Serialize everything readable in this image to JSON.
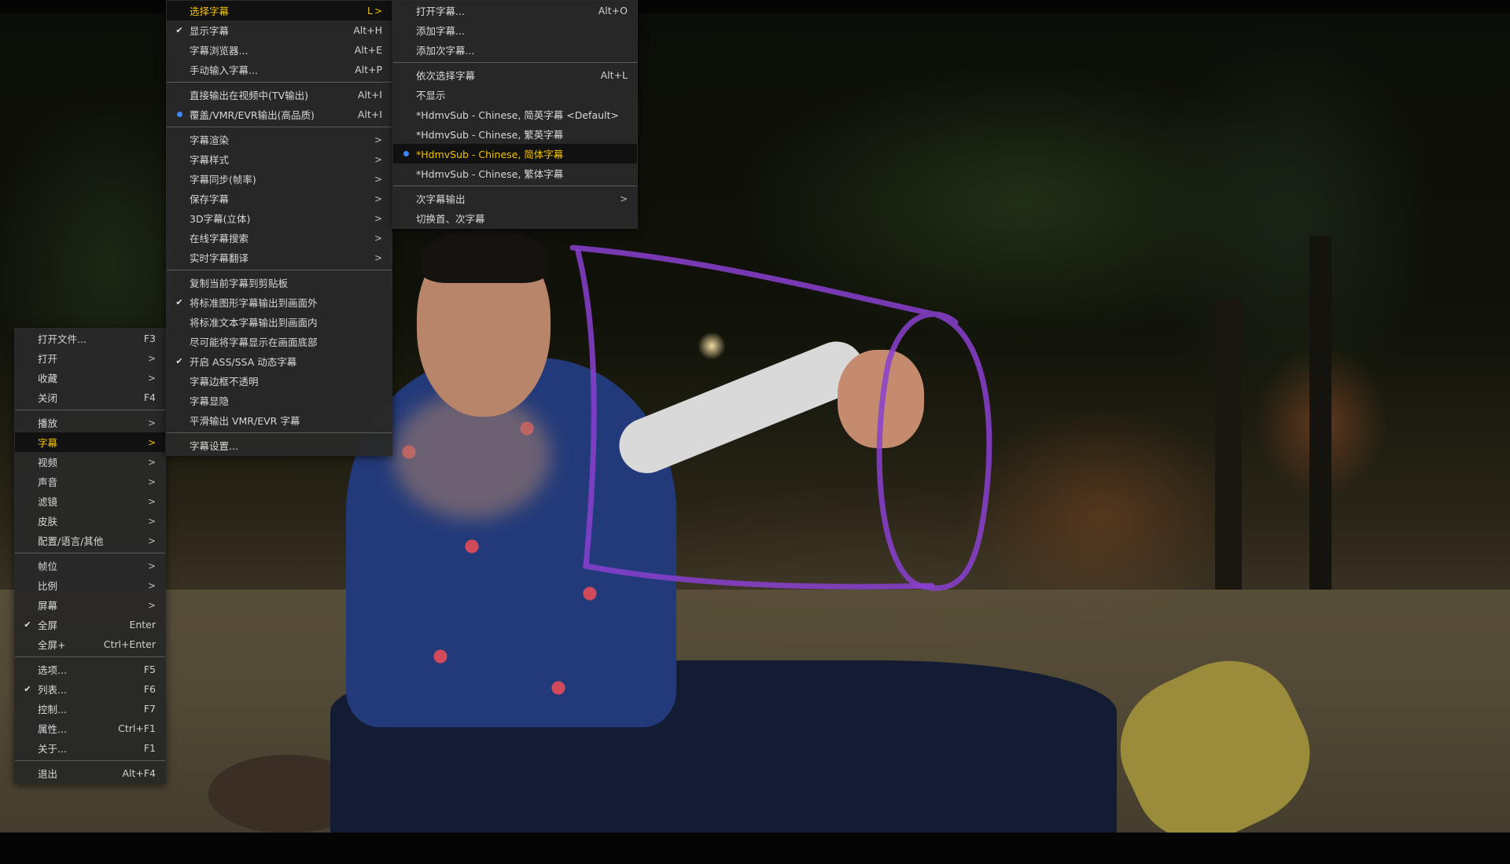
{
  "player_menu": {
    "items": [
      {
        "label": "打开文件...",
        "shortcut": "F3"
      },
      {
        "label": "打开",
        "arrow": ">"
      },
      {
        "label": "收藏",
        "arrow": ">"
      },
      {
        "label": "关闭",
        "shortcut": "F4"
      },
      {
        "label": "播放",
        "arrow": ">"
      },
      {
        "label": "字幕",
        "arrow": ">"
      },
      {
        "label": "视频",
        "arrow": ">"
      },
      {
        "label": "声音",
        "arrow": ">"
      },
      {
        "label": "滤镜",
        "arrow": ">"
      },
      {
        "label": "皮肤",
        "arrow": ">"
      },
      {
        "label": "配置/语言/其他",
        "arrow": ">"
      },
      {
        "label": "帧位",
        "arrow": ">"
      },
      {
        "label": "比例",
        "arrow": ">"
      },
      {
        "label": "屏幕",
        "arrow": ">"
      },
      {
        "label": "全屏",
        "shortcut": "Enter"
      },
      {
        "label": "全屏+",
        "shortcut": "Ctrl+Enter"
      },
      {
        "label": "选项...",
        "shortcut": "F5"
      },
      {
        "label": "列表...",
        "shortcut": "F6"
      },
      {
        "label": "控制...",
        "shortcut": "F7"
      },
      {
        "label": "属性...",
        "shortcut": "Ctrl+F1"
      },
      {
        "label": "关于...",
        "shortcut": "F1"
      },
      {
        "label": "退出",
        "shortcut": "Alt+F4"
      }
    ]
  },
  "subtitle_menu": {
    "items": [
      {
        "label": "选择字幕",
        "shortcut": "L",
        "arrow": ">"
      },
      {
        "label": "显示字幕",
        "shortcut": "Alt+H"
      },
      {
        "label": "字幕浏览器...",
        "shortcut": "Alt+E"
      },
      {
        "label": "手动输入字幕...",
        "shortcut": "Alt+P"
      },
      {
        "label": "直接输出在视频中(TV输出)",
        "shortcut": "Alt+I"
      },
      {
        "label": "覆盖/VMR/EVR输出(高品质)",
        "shortcut": "Alt+I"
      },
      {
        "label": "字幕渲染",
        "arrow": ">"
      },
      {
        "label": "字幕样式",
        "arrow": ">"
      },
      {
        "label": "字幕同步(帧率)",
        "arrow": ">"
      },
      {
        "label": "保存字幕",
        "arrow": ">"
      },
      {
        "label": "3D字幕(立体)",
        "arrow": ">"
      },
      {
        "label": "在线字幕搜索",
        "arrow": ">"
      },
      {
        "label": "实时字幕翻译",
        "arrow": ">"
      },
      {
        "label": "复制当前字幕到剪贴板"
      },
      {
        "label": "将标准图形字幕输出到画面外"
      },
      {
        "label": "将标准文本字幕输出到画面内"
      },
      {
        "label": "尽可能将字幕显示在画面底部"
      },
      {
        "label": "开启 ASS/SSA 动态字幕"
      },
      {
        "label": "字幕边框不透明"
      },
      {
        "label": "字幕显隐"
      },
      {
        "label": "平滑输出 VMR/EVR 字幕"
      },
      {
        "label": "字幕设置..."
      }
    ]
  },
  "select_subtitle_menu": {
    "items": [
      {
        "label": "打开字幕...",
        "shortcut": "Alt+O"
      },
      {
        "label": "添加字幕..."
      },
      {
        "label": "添加次字幕..."
      },
      {
        "label": "依次选择字幕",
        "shortcut": "Alt+L"
      },
      {
        "label": "不显示"
      },
      {
        "label": "*HdmvSub - Chinese, 简英字幕 <Default>"
      },
      {
        "label": "*HdmvSub - Chinese, 繁英字幕"
      },
      {
        "label": "*HdmvSub - Chinese, 简体字幕"
      },
      {
        "label": "*HdmvSub - Chinese, 繁体字幕"
      },
      {
        "label": "次字幕输出",
        "arrow": ">"
      },
      {
        "label": "切换首、次字幕"
      }
    ]
  },
  "colors": {
    "highlight_text": "#f2c200",
    "radio_dot": "#3c86ff",
    "menu_bg": "#282828"
  }
}
